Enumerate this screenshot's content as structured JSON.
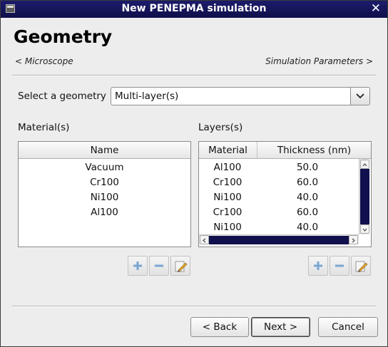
{
  "window": {
    "title": "New PENEPMA simulation",
    "close_symbol": "✕"
  },
  "page": {
    "heading": "Geometry",
    "prev_link": "< Microscope",
    "next_link": "Simulation Parameters >"
  },
  "geometry": {
    "label": "Select a geometry",
    "selected": "Multi-layer(s)"
  },
  "materials": {
    "label": "Material(s)",
    "column": "Name",
    "rows": [
      "Vacuum",
      "Cr100",
      "Ni100",
      "Al100"
    ]
  },
  "layers": {
    "label": "Layers(s)",
    "columns": [
      "Material",
      "Thickness (nm)"
    ],
    "rows": [
      {
        "material": "Al100",
        "thickness": "50.0"
      },
      {
        "material": "Cr100",
        "thickness": "60.0"
      },
      {
        "material": "Ni100",
        "thickness": "40.0"
      },
      {
        "material": "Cr100",
        "thickness": "60.0"
      },
      {
        "material": "Ni100",
        "thickness": "40.0"
      }
    ]
  },
  "buttons": {
    "back": "< Back",
    "next": "Next >",
    "cancel": "Cancel"
  },
  "icons": {
    "add": "plus-icon",
    "remove": "minus-icon",
    "edit": "edit-pencil-icon"
  },
  "colors": {
    "titlebar": "#14145c",
    "scroll_thumb": "#10104e",
    "add_icon": "#6f9fcf"
  }
}
